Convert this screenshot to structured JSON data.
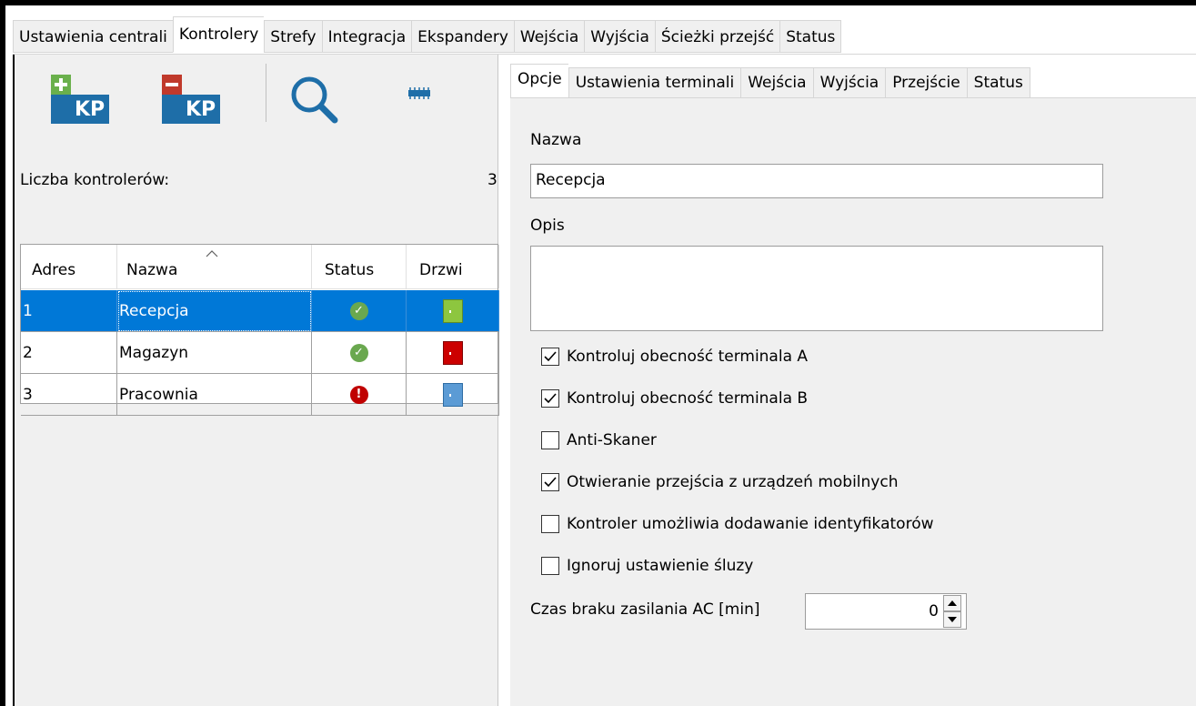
{
  "top_tabs": [
    "Ustawienia centrali",
    "Kontrolery",
    "Strefy",
    "Integracja",
    "Ekspandery",
    "Wejścia",
    "Wyjścia",
    "Ścieżki przejść",
    "Status"
  ],
  "active_top_tab": "Kontrolery",
  "toolbar": {
    "add_label": "KP",
    "remove_label": "KP"
  },
  "controllers": {
    "count_label": "Liczba kontrolerów:",
    "count_value": "3",
    "columns": [
      "Adres",
      "Nazwa",
      "Status",
      "Drzwi"
    ],
    "rows": [
      {
        "address": "1",
        "name": "Recepcja",
        "status": "ok",
        "door": "green"
      },
      {
        "address": "2",
        "name": "Magazyn",
        "status": "ok",
        "door": "red"
      },
      {
        "address": "3",
        "name": "Pracownia",
        "status": "error",
        "door": "blue"
      }
    ]
  },
  "sub_tabs": [
    "Opcje",
    "Ustawienia terminali",
    "Wejścia",
    "Wyjścia",
    "Przejście",
    "Status"
  ],
  "form": {
    "name_label": "Nazwa",
    "name_value": "Recepcja",
    "desc_label": "Opis",
    "desc_value": "",
    "checkboxes": [
      {
        "label": "Kontroluj obecność terminala A",
        "checked": true
      },
      {
        "label": "Kontroluj obecność terminala B",
        "checked": true
      },
      {
        "label": "Anti-Skaner",
        "checked": false
      },
      {
        "label": "Otwieranie przejścia z urządzeń mobilnych",
        "checked": true
      },
      {
        "label": "Kontroler umożliwia dodawanie identyfikatorów",
        "checked": false
      },
      {
        "label": "Ignoruj ustawienie śluzy",
        "checked": false
      }
    ],
    "ac_label": "Czas braku zasilania AC [min]",
    "ac_value": "0"
  },
  "colors": {
    "selection": "#0078d7",
    "ok": "#6aa84f",
    "error": "#c00000",
    "door_green": "#8dc63f",
    "door_red": "#cc0000",
    "door_blue": "#5b9bd5",
    "kp_blue": "#1e6ea8"
  }
}
